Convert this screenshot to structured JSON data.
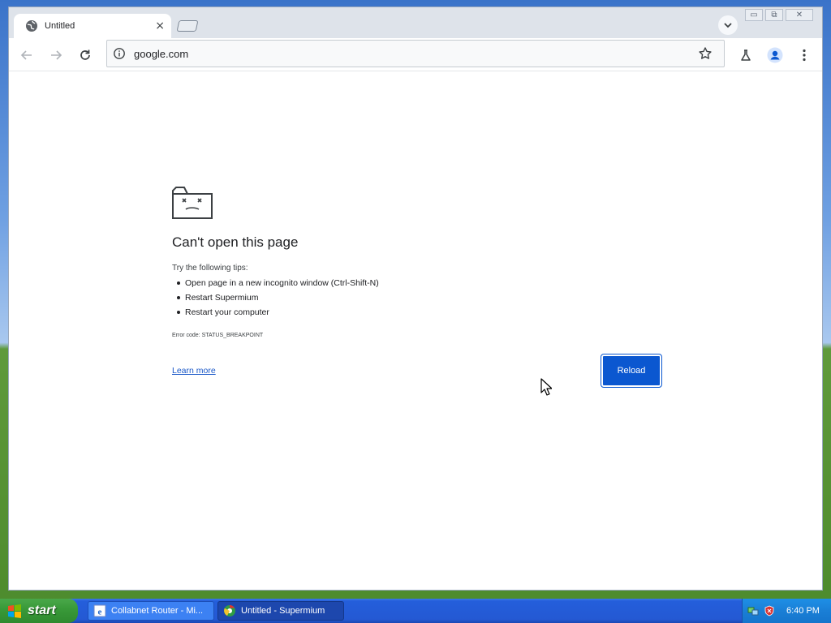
{
  "browser": {
    "tab": {
      "title": "Untitled",
      "close_glyph": "×"
    },
    "omnibox": {
      "url": "google.com"
    },
    "window_controls": {
      "minimize": "▭",
      "restore": "⧉",
      "close": "✕"
    }
  },
  "error_page": {
    "title": "Can't open this page",
    "tips_label": "Try the following tips:",
    "tips": [
      "Open page in a new incognito window (Ctrl-Shift-N)",
      "Restart Supermium",
      "Restart your computer"
    ],
    "error_code": "Error code: STATUS_BREAKPOINT",
    "learn_more": "Learn more",
    "reload_button": "Reload"
  },
  "taskbar": {
    "start_label": "start",
    "items": [
      {
        "label": "Collabnet Router - Mi...",
        "icon": "ie-icon",
        "active": false
      },
      {
        "label": "Untitled - Supermium",
        "icon": "supermium-icon",
        "active": true
      }
    ],
    "clock": "6:40 PM"
  },
  "colors": {
    "accent": "#0b57d0",
    "link": "#1a58c8",
    "taskbar": "#245edb",
    "start_button": "#3a9a3a"
  }
}
